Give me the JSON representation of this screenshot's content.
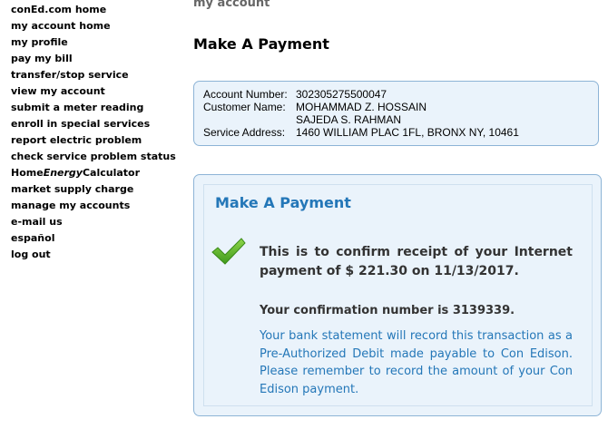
{
  "sidebar": {
    "items": [
      {
        "label": "conEd.com home"
      },
      {
        "label": "my account home"
      },
      {
        "label": "my profile"
      },
      {
        "label": "pay my bill"
      },
      {
        "label": "transfer/stop service"
      },
      {
        "label": "view my account"
      },
      {
        "label": "submit a meter reading"
      },
      {
        "label": "enroll in special services"
      },
      {
        "label": "report electric problem"
      },
      {
        "label": "check service problem status"
      },
      {
        "label_prefix": "Home",
        "label_em": "Energy",
        "label_suffix": "Calculator"
      },
      {
        "label": "market supply charge"
      },
      {
        "label": "manage my accounts"
      },
      {
        "label": "e-mail us"
      },
      {
        "label": "español"
      },
      {
        "label": "log out"
      }
    ]
  },
  "breadcrumb": "my account",
  "page_title": "Make A Payment",
  "account": {
    "number_label": "Account Number:",
    "number": "302305275500047",
    "name_label": "Customer Name:",
    "name_line1": "MOHAMMAD Z. HOSSAIN",
    "name_line2": "SAJEDA S. RAHMAN",
    "address_label": "Service Address:",
    "address": "1460 WILLIAM PLAC 1FL, BRONX NY, 10461"
  },
  "payment_panel": {
    "title": "Make A Payment",
    "confirm_message": "This is to confirm receipt of your Internet payment of $ 221.30 on 11/13/2017.",
    "confirmation_number_message": "Your confirmation number is 3139339.",
    "bank_message": "Your bank statement will record this transaction as a Pre-Authorized Debit made payable to Con Edison. Please remember to record the amount of your Con Edison payment."
  },
  "icons": {
    "success": "check-icon"
  },
  "colors": {
    "accent_blue": "#2477b8",
    "panel_bg": "#eaf3fb",
    "panel_border": "#8db4d6",
    "check_green": "#5fb42a"
  }
}
